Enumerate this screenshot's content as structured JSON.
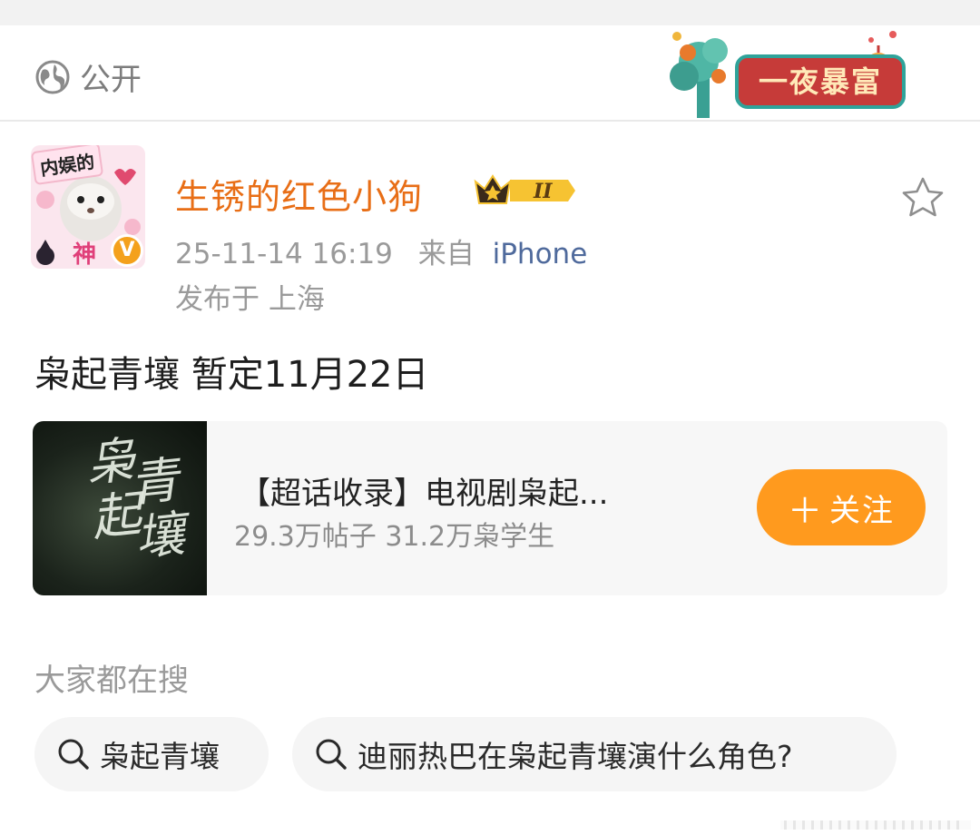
{
  "header": {
    "visibility_label": "公开",
    "visibility_icon": "globe-icon",
    "banner_text": "一夜暴富"
  },
  "post": {
    "author": {
      "name": "生锈的红色小狗",
      "avatar_tag": "内娱的",
      "avatar_caption": "神",
      "verified_badge": "V",
      "level_badge": "II"
    },
    "timestamp": "25-11-14 16:19",
    "source_prefix": "来自",
    "source": "iPhone",
    "location": "发布于 上海",
    "text": "枭起青壤 暂定11月22日",
    "favorite_icon": "star-icon"
  },
  "card": {
    "cover_text": [
      "枭",
      "起",
      "青",
      "壤"
    ],
    "title": "【超话收录】电视剧枭起...",
    "subtitle": "29.3万帖子 31.2万枭学生",
    "follow_plus": "＋",
    "follow_label": "关注",
    "accent_color": "#ff9a1e"
  },
  "search": {
    "section_title": "大家都在搜",
    "chips": [
      {
        "label": "枭起青壤",
        "icon": "search-icon"
      },
      {
        "label": "迪丽热巴在枭起青壤演什么角色?",
        "icon": "search-icon"
      }
    ]
  },
  "colors": {
    "username": "#e86e16",
    "source_link": "#4f6a9c",
    "meta_text": "#9a9a9a"
  }
}
